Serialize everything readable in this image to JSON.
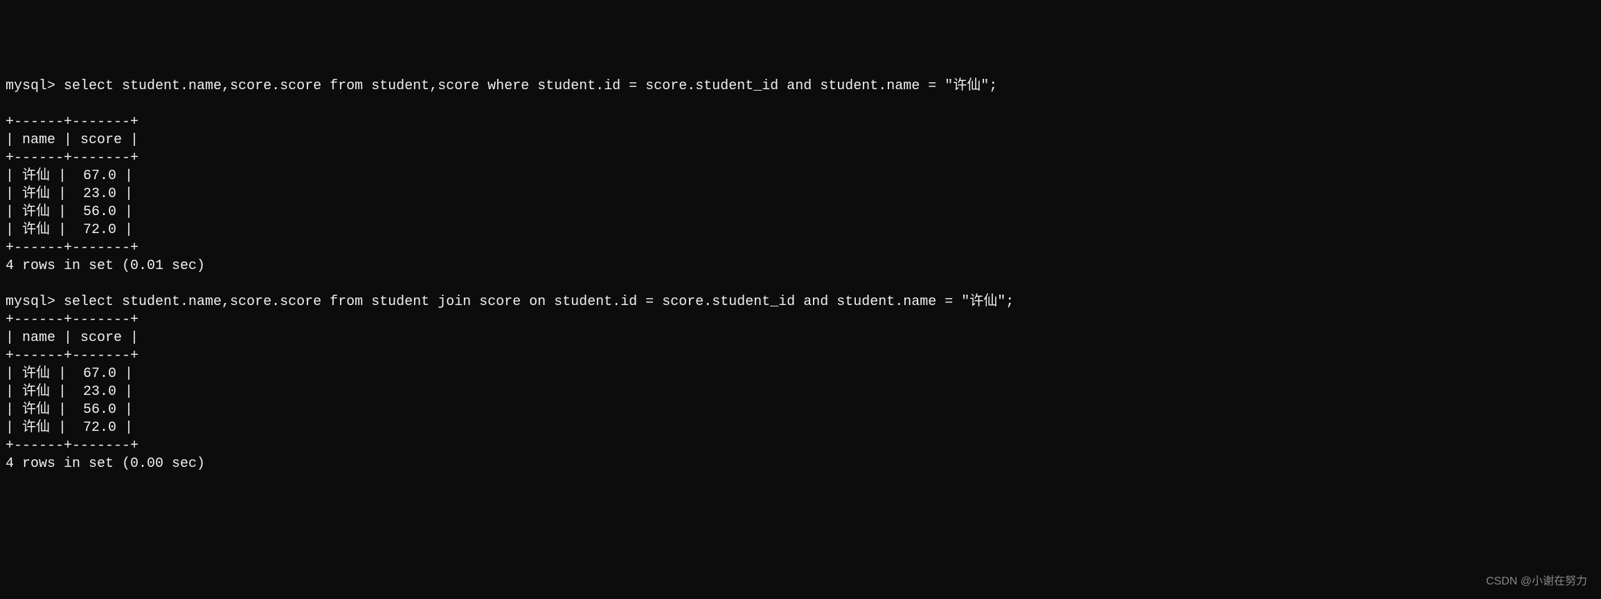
{
  "query1": {
    "prompt": "mysql> ",
    "sql": "select student.name,score.score from student,score where student.id = score.student_id and student.name = \"许仙\";",
    "table_border_top": "+------+-------+",
    "table_header": "| name | score |",
    "table_border_mid": "+------+-------+",
    "rows": [
      "| 许仙 |  67.0 |",
      "| 许仙 |  23.0 |",
      "| 许仙 |  56.0 |",
      "| 许仙 |  72.0 |"
    ],
    "table_border_bottom": "+------+-------+",
    "result_status": "4 rows in set (0.01 sec)"
  },
  "query2": {
    "prompt": "mysql> ",
    "sql": "select student.name,score.score from student join score on student.id = score.student_id and student.name = \"许仙\";",
    "table_border_top": "+------+-------+",
    "table_header": "| name | score |",
    "table_border_mid": "+------+-------+",
    "rows": [
      "| 许仙 |  67.0 |",
      "| 许仙 |  23.0 |",
      "| 许仙 |  56.0 |",
      "| 许仙 |  72.0 |"
    ],
    "table_border_bottom": "+------+-------+",
    "result_status": "4 rows in set (0.00 sec)"
  },
  "watermark": "CSDN @小谢在努力",
  "chart_data": {
    "type": "table",
    "title": "MySQL query results for student named 许仙",
    "columns": [
      "name",
      "score"
    ],
    "rows": [
      {
        "name": "许仙",
        "score": 67.0
      },
      {
        "name": "许仙",
        "score": 23.0
      },
      {
        "name": "许仙",
        "score": 56.0
      },
      {
        "name": "许仙",
        "score": 72.0
      }
    ]
  }
}
